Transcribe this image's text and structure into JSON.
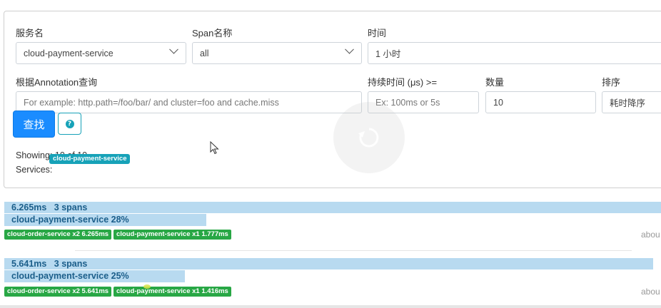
{
  "form": {
    "service_label": "服务名",
    "service_value": "cloud-payment-service",
    "span_label": "Span名称",
    "span_value": "all",
    "time_label": "时间",
    "time_value": "1 小时",
    "annotation_label": "根据Annotation查询",
    "annotation_placeholder": "For example: http.path=/foo/bar/ and cluster=foo and cache.miss",
    "duration_label": "持续时间 (μs) >=",
    "duration_placeholder": "Ex: 100ms or 5s",
    "limit_label": "数量",
    "limit_value": "10",
    "sort_label": "排序",
    "sort_value": "耗时降序",
    "search_label": "查找",
    "help_glyph": "?"
  },
  "results": {
    "showing": "Showing: 10 of 10",
    "services_label": "Services:",
    "services_badge": "cloud-payment-service"
  },
  "traces": [
    {
      "duration_spans": "6.265ms   3 spans",
      "service_line": "cloud-payment-service 28%",
      "service_fraction": 0.28,
      "tags": [
        "cloud-order-service x2 6.265ms",
        "cloud-payment-service x1 1.777ms"
      ],
      "ago": "abou"
    },
    {
      "duration_spans": "5.641ms   3 spans",
      "service_line": "cloud-payment-service 25%",
      "service_fraction": 0.25,
      "tags": [
        "cloud-order-service x2 5.641ms",
        "cloud-payment-service x1 1.416ms"
      ],
      "ago": "abou"
    }
  ],
  "icons": {
    "dropdown": "chevron-down-icon",
    "help": "question-circle-icon",
    "overlay": "replay-icon",
    "cursor": "mouse-cursor-icon"
  },
  "colors": {
    "primary": "#1a8cff",
    "info": "#17a2b8",
    "success": "#28a745",
    "bar": "#b8daf0",
    "bar_text": "#1b5e8a"
  }
}
